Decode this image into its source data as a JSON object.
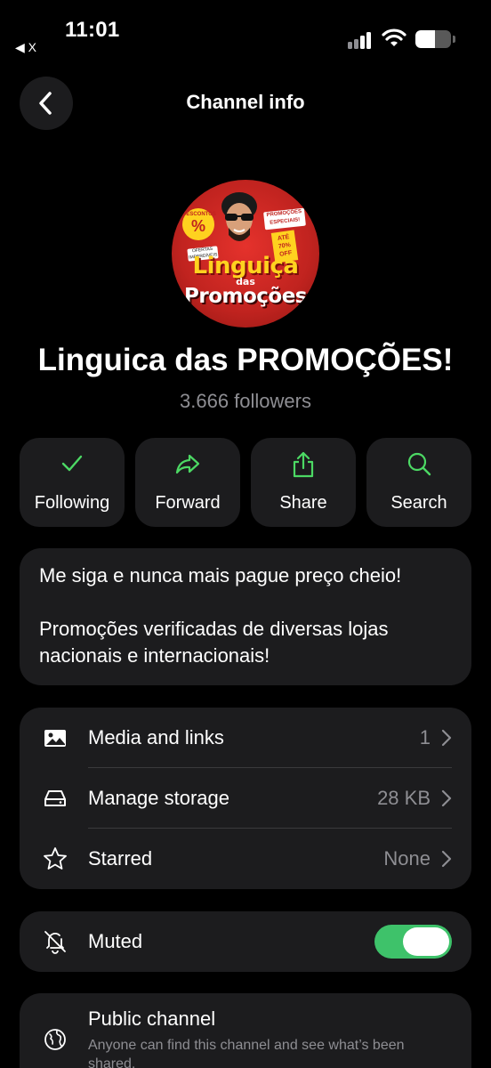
{
  "status_bar": {
    "time": "11:01",
    "back_app": "◀ X",
    "battery_level": 0.55
  },
  "header": {
    "title": "Channel info"
  },
  "channel": {
    "avatar": {
      "line1": "Linguiça",
      "line2": "das",
      "line3": "Promoções",
      "badge_left_top": "DESCONTOS",
      "badge_left_symbol": "%",
      "badge_right": "PROMOÇÕES ESPECIAIS!",
      "badge_tag": "ATÉ 70% OFF",
      "badge_mini": "OFERTAS IMPERDÍVEIS"
    },
    "name": "Linguica das PROMOÇÕES!",
    "followers": "3.666 followers"
  },
  "actions": [
    {
      "label": "Following",
      "icon": "checkmark-icon"
    },
    {
      "label": "Forward",
      "icon": "forward-arrow-icon"
    },
    {
      "label": "Share",
      "icon": "share-icon"
    },
    {
      "label": "Search",
      "icon": "search-icon"
    }
  ],
  "accent_color": "#4cd964",
  "description": {
    "line1": "Me siga e nunca mais pague preço cheio!",
    "line2": "Promoções verificadas de diversas lojas nacionais e internacionais!"
  },
  "info_rows": [
    {
      "label": "Media and links",
      "value": "1",
      "icon": "photo-icon"
    },
    {
      "label": "Manage storage",
      "value": "28 KB",
      "icon": "storage-icon"
    },
    {
      "label": "Starred",
      "value": "None",
      "icon": "star-icon"
    }
  ],
  "muted": {
    "label": "Muted",
    "icon": "bell-slash-icon",
    "enabled": true
  },
  "public_channel": {
    "title": "Public channel",
    "subtitle": "Anyone can find this channel and see what’s been shared."
  }
}
